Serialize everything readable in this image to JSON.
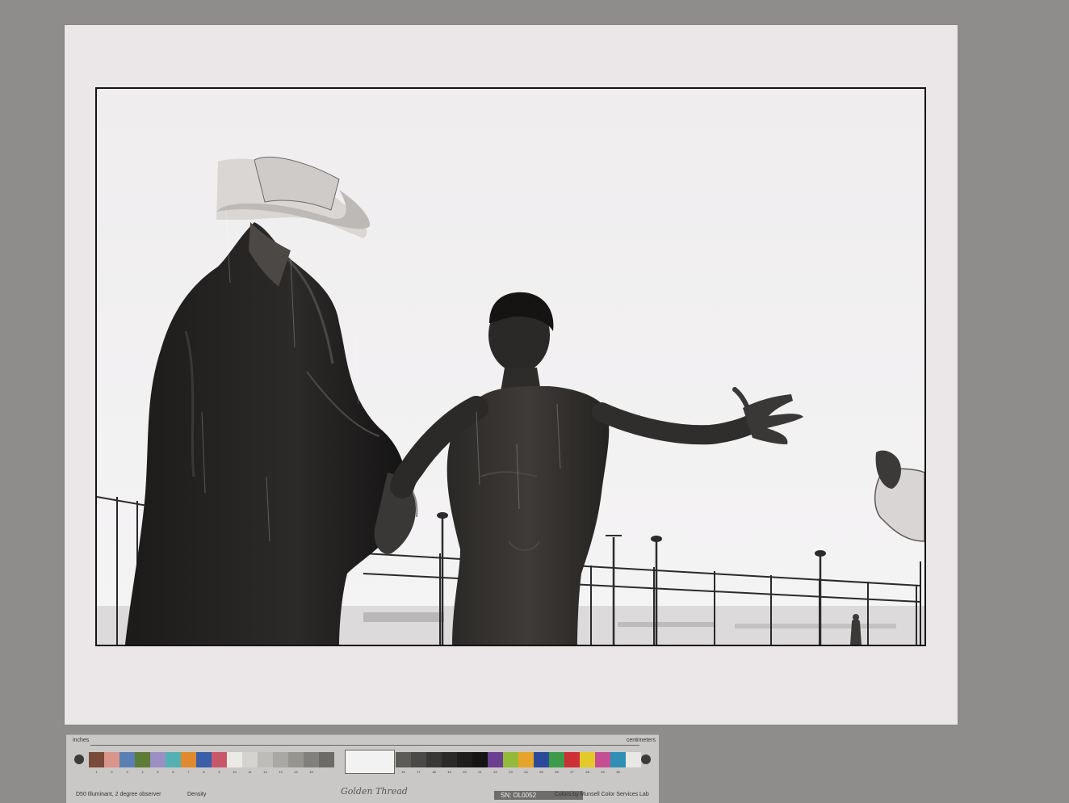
{
  "target": {
    "left_labels": [
      "inches",
      "D50 Illuminant, 2 degree observer",
      "Density"
    ],
    "right_labels": [
      "centimeters",
      "Colors by Munsell Color Services Lab"
    ],
    "brand": "Golden Thread",
    "serial": "SN: OL0052",
    "numbers_left": [
      "1",
      "2",
      "3",
      "4",
      "5",
      "6",
      "7",
      "8",
      "9",
      "10",
      "11",
      "12",
      "13",
      "14",
      "15"
    ],
    "numbers_right": [
      "16",
      "17",
      "18",
      "19",
      "20",
      "21",
      "22",
      "23",
      "24",
      "25",
      "26",
      "27",
      "28",
      "29",
      "30"
    ],
    "colors": {
      "patches_left": [
        "#7a4a3a",
        "#d9958c",
        "#5b7fb3",
        "#5b7d38",
        "#9c8fc4",
        "#54b0b3",
        "#e08a2e",
        "#3a5fa8",
        "#c9576a",
        "#eceae6",
        "#d5d3d0",
        "#bdbcb9",
        "#a9a8a5",
        "#96958f",
        "#81807c",
        "#6c6b68"
      ],
      "patches_right": [
        "#5c5b58",
        "#4a4947",
        "#393837",
        "#2b2a29",
        "#1e1d1c",
        "#141413",
        "#6a3f8f",
        "#95b93b",
        "#e6a52a",
        "#2d4a9a",
        "#3d9a4a",
        "#cc2f36",
        "#e4c92a",
        "#c44f93",
        "#2f8fb4",
        "#e8e8e6"
      ]
    }
  }
}
